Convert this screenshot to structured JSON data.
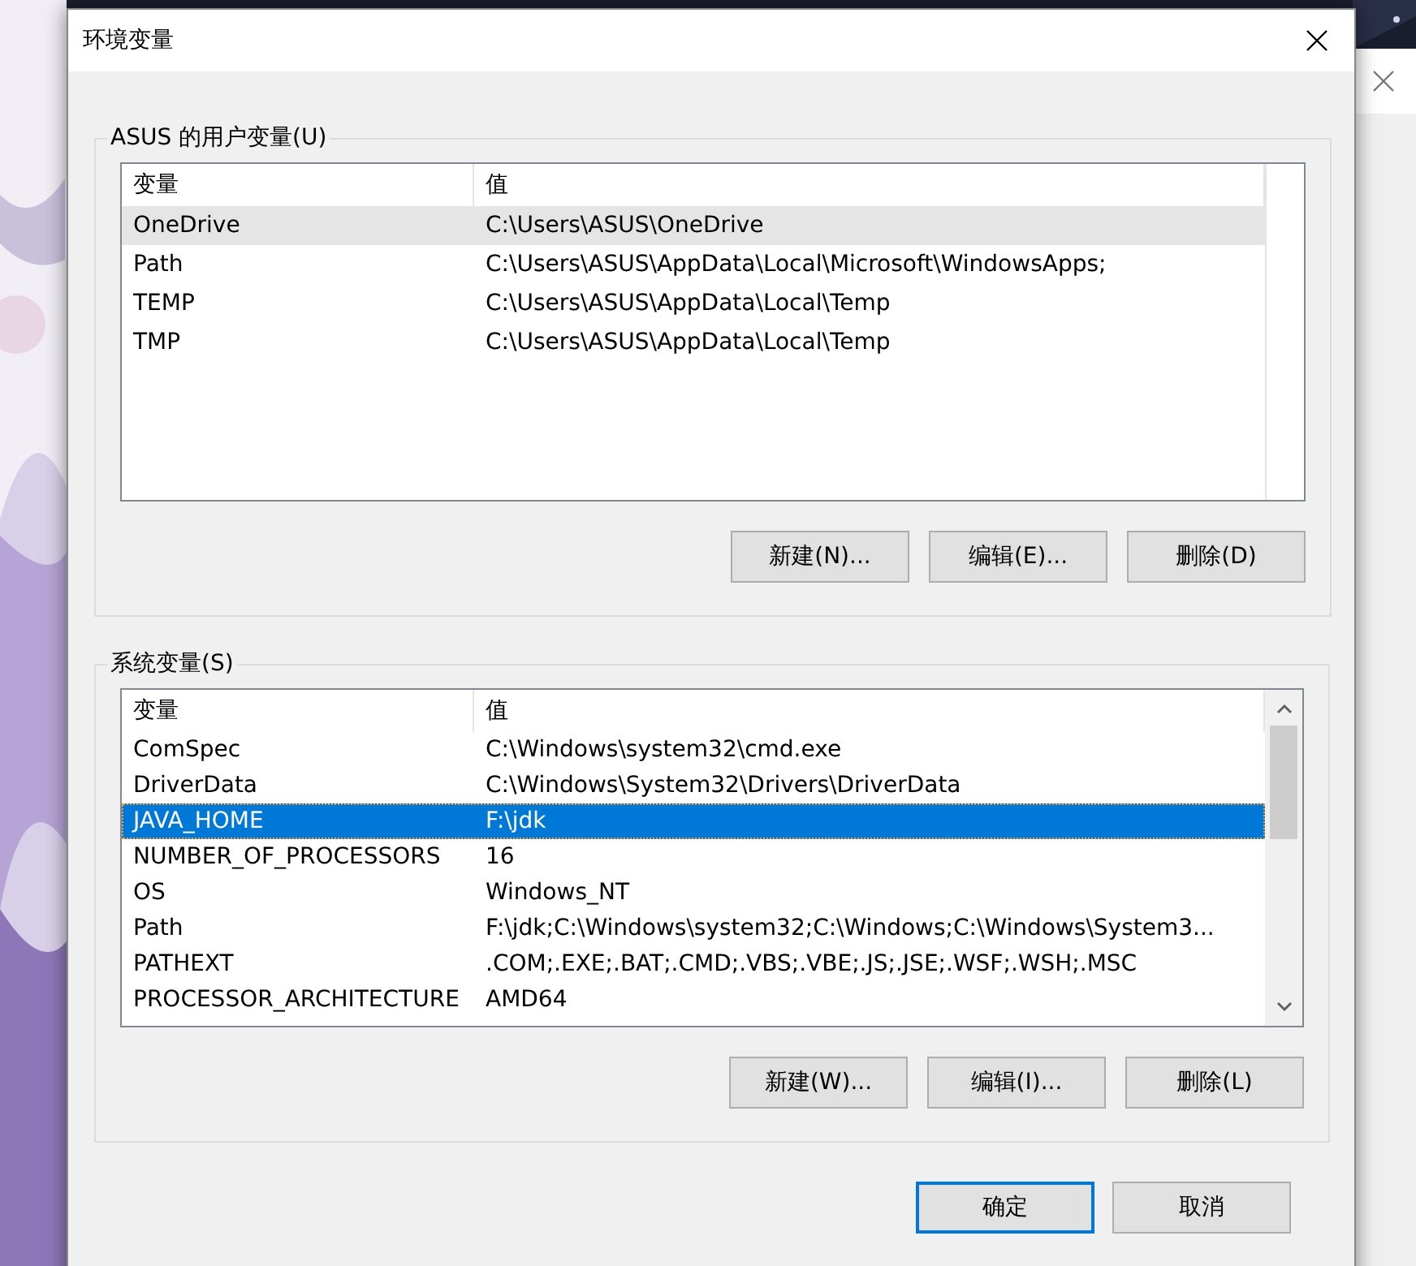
{
  "window": {
    "title": "环境变量"
  },
  "user_variables": {
    "title": "ASUS 的用户变量(U)",
    "columns": [
      "变量",
      "值"
    ],
    "rows": [
      {
        "name": "OneDrive",
        "value": "C:\\Users\\ASUS\\OneDrive",
        "selected": true
      },
      {
        "name": "Path",
        "value": "C:\\Users\\ASUS\\AppData\\Local\\Microsoft\\WindowsApps;",
        "selected": false
      },
      {
        "name": "TEMP",
        "value": "C:\\Users\\ASUS\\AppData\\Local\\Temp",
        "selected": false
      },
      {
        "name": "TMP",
        "value": "C:\\Users\\ASUS\\AppData\\Local\\Temp",
        "selected": false
      }
    ],
    "buttons": [
      "新建(N)...",
      "编辑(E)...",
      "删除(D)"
    ]
  },
  "system_variables": {
    "title": "系统变量(S)",
    "columns": [
      "变量",
      "值"
    ],
    "rows": [
      {
        "name": "ComSpec",
        "value": "C:\\Windows\\system32\\cmd.exe",
        "selected": false
      },
      {
        "name": "DriverData",
        "value": "C:\\Windows\\System32\\Drivers\\DriverData",
        "selected": false
      },
      {
        "name": "JAVA_HOME",
        "value": "F:\\jdk",
        "selected": true
      },
      {
        "name": "NUMBER_OF_PROCESSORS",
        "value": "16",
        "selected": false
      },
      {
        "name": "OS",
        "value": "Windows_NT",
        "selected": false
      },
      {
        "name": "Path",
        "value": "F:\\jdk;C:\\Windows\\system32;C:\\Windows;C:\\Windows\\System3...",
        "selected": false
      },
      {
        "name": "PATHEXT",
        "value": ".COM;.EXE;.BAT;.CMD;.VBS;.VBE;.JS;.JSE;.WSF;.WSH;.MSC",
        "selected": false
      },
      {
        "name": "PROCESSOR_ARCHITECTURE",
        "value": "AMD64",
        "selected": false
      }
    ],
    "buttons": [
      "新建(W)...",
      "编辑(I)...",
      "删除(L)"
    ]
  },
  "footer_buttons": [
    {
      "label": "确定",
      "focused": true
    },
    {
      "label": "取消",
      "focused": false
    }
  ]
}
